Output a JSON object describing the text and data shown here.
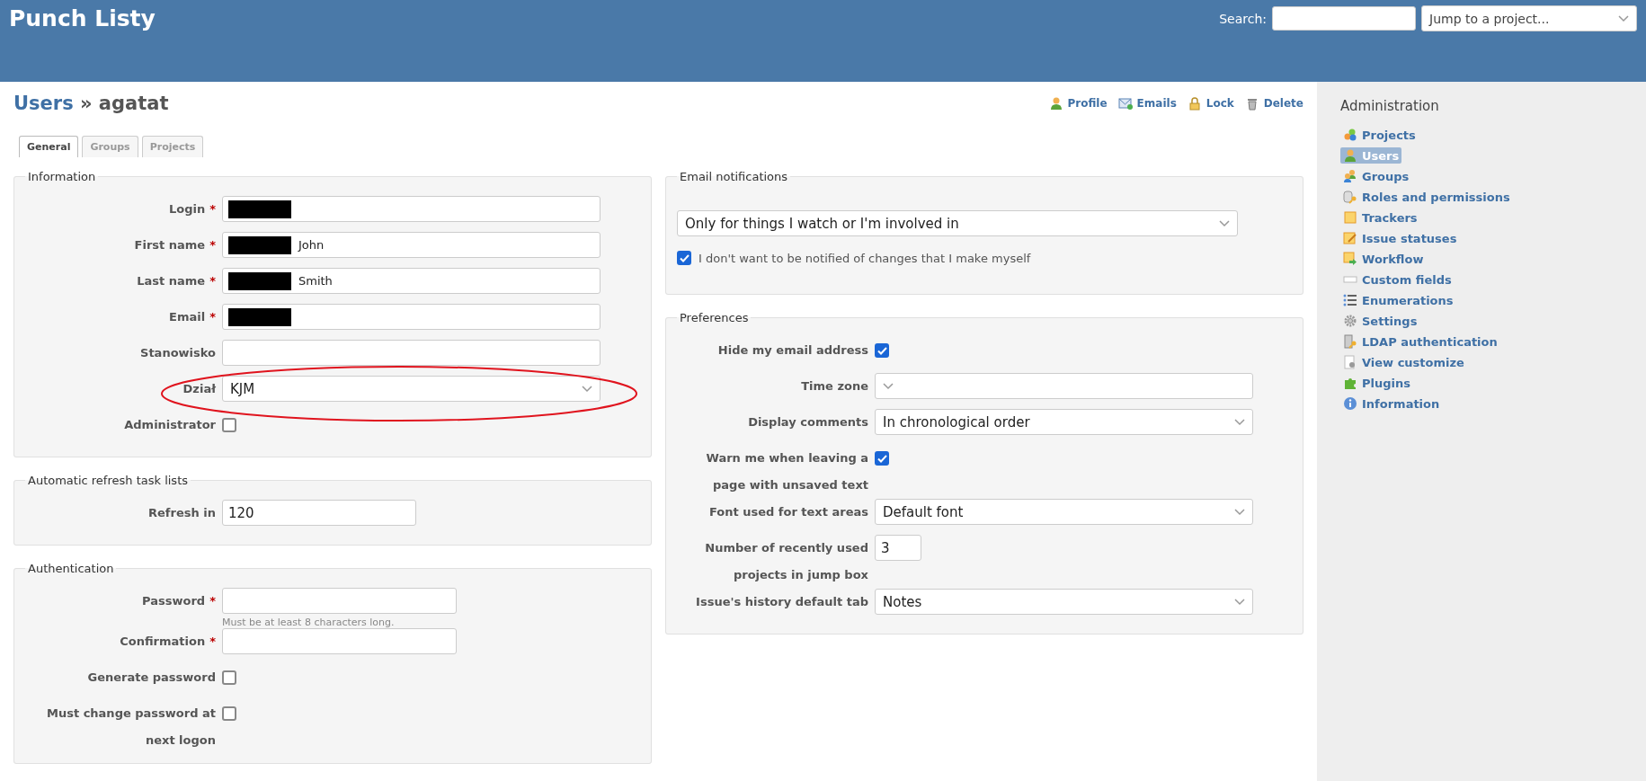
{
  "header": {
    "title": "Punch Listy",
    "search_label": "Search:",
    "jump_placeholder": "Jump to a project..."
  },
  "breadcrumb": {
    "link": "Users",
    "separator": "»",
    "current": "agatat"
  },
  "actions": [
    {
      "label": "Profile",
      "kind": "person"
    },
    {
      "label": "Emails",
      "kind": "envelope"
    },
    {
      "label": "Lock",
      "kind": "lock"
    },
    {
      "label": "Delete",
      "kind": "trash"
    }
  ],
  "tabs": [
    {
      "label": "General",
      "selected": true
    },
    {
      "label": "Groups",
      "selected": false
    },
    {
      "label": "Projects",
      "selected": false
    }
  ],
  "left_sections": [
    {
      "legend": "Information",
      "fields": [
        {
          "kind": "text",
          "label": "Login",
          "required_mark": "*",
          "redacted": true
        },
        {
          "kind": "text",
          "label": "First name",
          "required_mark": "*",
          "redacted": true,
          "value": "John"
        },
        {
          "kind": "text",
          "label": "Last name",
          "required_mark": "*",
          "redacted": true,
          "value": "Smith"
        },
        {
          "kind": "text",
          "label": "Email",
          "required_mark": "*",
          "redacted": true
        },
        {
          "kind": "text",
          "label": "Stanowisko"
        },
        {
          "kind": "select",
          "label": "Dział",
          "value": "KJM",
          "circled": true
        },
        {
          "kind": "checkbox",
          "label": "Administrator",
          "checked": false
        }
      ]
    },
    {
      "legend": "Automatic refresh task lists",
      "fields": [
        {
          "kind": "short_text",
          "label": "Refresh in",
          "value": "120"
        }
      ]
    },
    {
      "legend": "Authentication",
      "fields": [
        {
          "kind": "medium_text",
          "label": "Password",
          "required_mark": "*",
          "hint": "Must be at least 8 characters long."
        },
        {
          "kind": "medium_text",
          "label": "Confirmation",
          "required_mark": "*"
        },
        {
          "kind": "checkbox",
          "label": "Generate password",
          "checked": false
        },
        {
          "kind": "checkbox",
          "label": "Must change password at next logon",
          "checked": false
        }
      ]
    }
  ],
  "right_sections": [
    {
      "legend": "Email notifications",
      "fields": [
        {
          "kind": "wide_select",
          "value": "Only for things I watch or I'm involved in"
        },
        {
          "kind": "inline_checkbox",
          "label": "I don't want to be notified of changes that I make myself",
          "checked": true
        }
      ]
    },
    {
      "legend": "Preferences",
      "fields": [
        {
          "kind": "checkbox",
          "label": "Hide my email address",
          "checked": true
        },
        {
          "kind": "select",
          "label": "Time zone"
        },
        {
          "kind": "select",
          "label": "Display comments",
          "value": "In chronological order"
        },
        {
          "kind": "checkbox",
          "label": "Warn me when leaving a page with unsaved text",
          "checked": true
        },
        {
          "kind": "select",
          "label": "Font used for text areas",
          "value": "Default font"
        },
        {
          "kind": "tiny_text",
          "label": "Number of recently used projects in jump box",
          "value": "3"
        },
        {
          "kind": "select",
          "label": "Issue's history default tab",
          "value": "Notes"
        }
      ]
    }
  ],
  "sidebar": {
    "title": "Administration",
    "items": [
      {
        "label": "Projects",
        "kind": "projects",
        "selected": false
      },
      {
        "label": "Users",
        "kind": "person",
        "selected": true
      },
      {
        "label": "Groups",
        "kind": "groups",
        "selected": false
      },
      {
        "label": "Roles and permissions",
        "kind": "roles",
        "selected": false
      },
      {
        "label": "Trackers",
        "kind": "trackers",
        "selected": false
      },
      {
        "label": "Issue statuses",
        "kind": "statuses",
        "selected": false
      },
      {
        "label": "Workflow",
        "kind": "workflow",
        "selected": false
      },
      {
        "label": "Custom fields",
        "kind": "custom_fields",
        "selected": false
      },
      {
        "label": "Enumerations",
        "kind": "enumerations",
        "selected": false
      },
      {
        "label": "Settings",
        "kind": "settings",
        "selected": false
      },
      {
        "label": "LDAP authentication",
        "kind": "ldap",
        "selected": false
      },
      {
        "label": "View customize",
        "kind": "view_customize",
        "selected": false
      },
      {
        "label": "Plugins",
        "kind": "plugins",
        "selected": false
      },
      {
        "label": "Information",
        "kind": "information",
        "selected": false
      }
    ]
  }
}
